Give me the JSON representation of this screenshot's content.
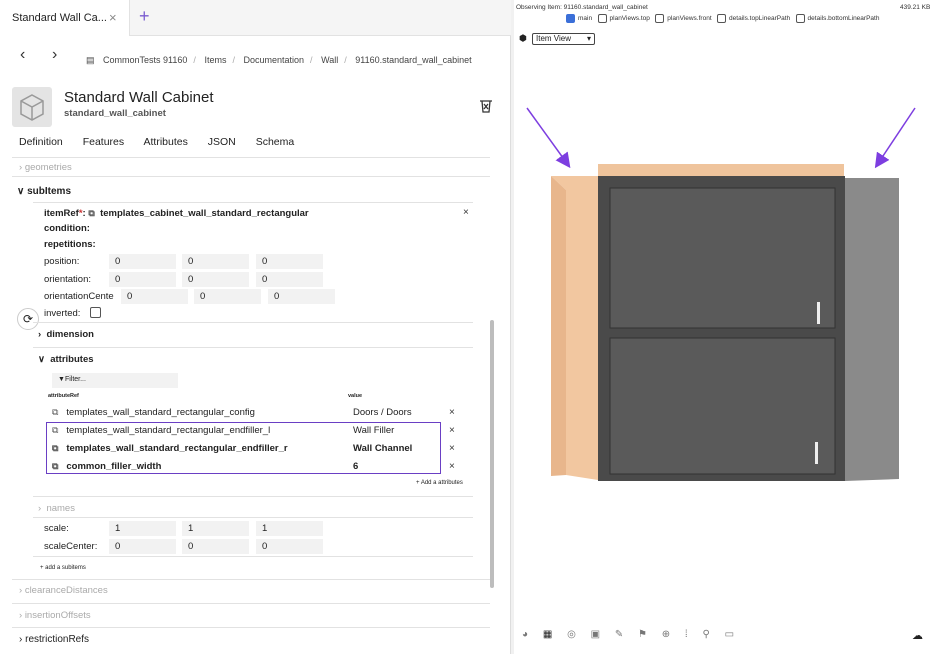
{
  "tab": {
    "title": "Standard Wall Ca...",
    "close": "×",
    "add": "+"
  },
  "breadcrumb": [
    "CommonTests 91160",
    "Items",
    "Documentation",
    "Wall",
    "91160.standard_wall_cabinet"
  ],
  "header": {
    "title": "Standard Wall Cabinet",
    "subtitle": "standard_wall_cabinet"
  },
  "main_tabs": [
    "Definition",
    "Features",
    "Attributes",
    "JSON",
    "Schema"
  ],
  "tree": {
    "geometries": "geometries",
    "subitems": "subItems",
    "itemref_label": "itemRef",
    "itemref_star": "*",
    "itemref_value": "templates_cabinet_wall_standard_rectangular",
    "condition": "condition:",
    "repetitions": "repetitions:",
    "position": {
      "label": "position:",
      "values": [
        "0",
        "0",
        "0"
      ]
    },
    "orientation": {
      "label": "orientation:",
      "values": [
        "0",
        "0",
        "0"
      ]
    },
    "orientationCenter": {
      "label": "orientationCente",
      "values": [
        "0",
        "0",
        "0"
      ]
    },
    "inverted": "inverted:",
    "dimension": "dimension",
    "attributes": "attributes",
    "filter": "Filter...",
    "col_ref": "attributeRef",
    "col_value": "value",
    "attr_rows": [
      {
        "ref": "templates_wall_standard_rectangular_config",
        "value": "Doors / Doors",
        "bold": false
      },
      {
        "ref": "templates_wall_standard_rectangular_endfiller_l",
        "value": "Wall Filler",
        "bold": false
      },
      {
        "ref": "templates_wall_standard_rectangular_endfiller_r",
        "value": "Wall Channel",
        "bold": true
      },
      {
        "ref": "common_filler_width",
        "value": "6",
        "bold": true
      }
    ],
    "add_attributes": "+ Add a attributes",
    "names": "names",
    "scale": {
      "label": "scale:",
      "values": [
        "1",
        "1",
        "1"
      ]
    },
    "scaleCenter": {
      "label": "scaleCenter:",
      "values": [
        "0",
        "0",
        "0"
      ]
    },
    "add_subitems": "+ add a subitems",
    "clearanceDistances": "clearanceDistances",
    "insertionOffsets": "insertionOffsets",
    "restrictionRefs": "restrictionRefs"
  },
  "viewer": {
    "observing": "Observing Item: 91160.standard_wall_cabinet",
    "size": "439.21 KB",
    "checks": [
      {
        "label": "main",
        "on": true
      },
      {
        "label": "planViews.top",
        "on": false
      },
      {
        "label": "planViews.front",
        "on": false
      },
      {
        "label": "details.topLinearPath",
        "on": false
      },
      {
        "label": "details.bottomLinearPath",
        "on": false
      }
    ],
    "view_select": "Item View"
  },
  "colors": {
    "accent": "#6a3fc4",
    "cabinet": "#4a4a4a",
    "filler": "#f2c7a0",
    "channel": "#8a8a8a"
  }
}
